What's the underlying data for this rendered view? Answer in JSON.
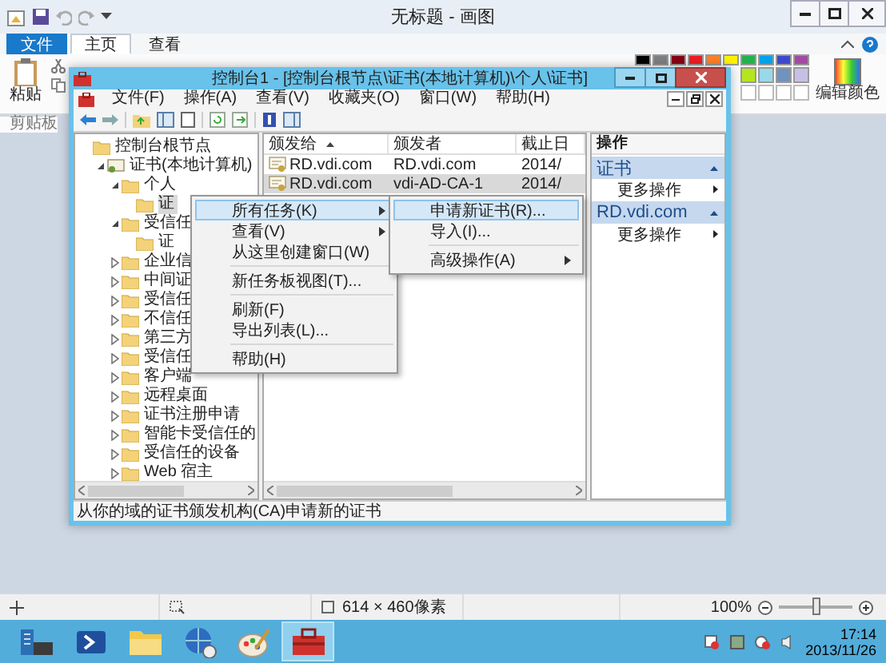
{
  "paint": {
    "title": "无标题 - 画图",
    "tabs": [
      {
        "label": "文件",
        "kind": "file",
        "selected": false
      },
      {
        "label": "主页",
        "kind": "tab",
        "selected": true
      },
      {
        "label": "查看",
        "kind": "tab",
        "selected": false
      }
    ],
    "ribbon": {
      "paste_label": "粘贴",
      "group_label": "剪贴板",
      "edit_colors_label": "编辑颜色",
      "palette_top": [
        {
          "color": "#000000"
        },
        {
          "color": "#7f7f7f"
        },
        {
          "color": "#880015"
        },
        {
          "color": "#ed1c24"
        },
        {
          "color": "#ff7f27"
        },
        {
          "color": "#fff200"
        },
        {
          "color": "#22b14c"
        },
        {
          "color": "#00a2e8"
        },
        {
          "color": "#3f48cc"
        },
        {
          "color": "#a349a4"
        }
      ],
      "palette_second": [
        {
          "color": "#b5e61d"
        },
        {
          "color": "#99d9ea"
        },
        {
          "color": "#7092be"
        },
        {
          "color": "#c8bfe7"
        }
      ]
    },
    "status": {
      "size": "614 × 460像素",
      "zoom": "100%",
      "level": 0.5
    }
  },
  "mmc": {
    "title": "控制台1 - [控制台根节点\\证书(本地计算机)\\个人\\证书]",
    "menu": [
      "文件(F)",
      "操作(A)",
      "查看(V)",
      "收藏夹(O)",
      "窗口(W)",
      "帮助(H)"
    ],
    "tree": [
      {
        "label": "控制台根节点",
        "kind": "plain",
        "selected": false,
        "children": [
          {
            "label": "证书(本地计算机)",
            "kind": "store",
            "expanded": true,
            "selected": false,
            "children": [
              {
                "label": "个人",
                "kind": "folder",
                "expanded": true,
                "selected": false,
                "children": [
                  {
                    "label": "证",
                    "kind": "plain",
                    "selected": true
                  }
                ]
              },
              {
                "label": "受信任",
                "kind": "folder",
                "expanded": true,
                "selected": false,
                "children": [
                  {
                    "label": "证",
                    "kind": "plain",
                    "selected": false
                  }
                ]
              },
              {
                "label": "企业信",
                "kind": "folder",
                "expanded": false,
                "selected": false
              },
              {
                "label": "中间证",
                "kind": "folder",
                "expanded": false,
                "selected": false
              },
              {
                "label": "受信任",
                "kind": "folder",
                "expanded": false,
                "selected": false
              },
              {
                "label": "不信任",
                "kind": "folder",
                "expanded": false,
                "selected": false
              },
              {
                "label": "第三方",
                "kind": "folder",
                "expanded": false,
                "selected": false
              },
              {
                "label": "受信任",
                "kind": "folder",
                "expanded": false,
                "selected": false
              },
              {
                "label": "客户端",
                "kind": "folder",
                "expanded": false,
                "selected": false
              },
              {
                "label": "远程桌面",
                "kind": "folder",
                "expanded": false,
                "selected": false
              },
              {
                "label": "证书注册申请",
                "kind": "folder",
                "expanded": false,
                "selected": false
              },
              {
                "label": "智能卡受信任的",
                "kind": "folder",
                "expanded": false,
                "selected": false
              },
              {
                "label": "受信任的设备",
                "kind": "folder",
                "expanded": false,
                "selected": false
              },
              {
                "label": "Web 宿主",
                "kind": "folder",
                "expanded": false,
                "selected": false
              }
            ]
          }
        ]
      }
    ],
    "columns": [
      {
        "label": "颁发给",
        "sorted": true
      },
      {
        "label": "颁发者",
        "sorted": false
      },
      {
        "label": "截止日",
        "sorted": false
      }
    ],
    "rows": [
      {
        "cells": [
          "RD.vdi.com",
          "RD.vdi.com",
          "2014/"
        ],
        "selected": false
      },
      {
        "cells": [
          "RD.vdi.com",
          "vdi-AD-CA-1",
          "2014/"
        ],
        "selected": true
      }
    ],
    "actions": {
      "title": "操作",
      "sections": [
        {
          "title": "证书",
          "items": [
            "更多操作"
          ]
        },
        {
          "title": "RD.vdi.com",
          "items": [
            "更多操作"
          ]
        }
      ]
    },
    "context_menu": [
      {
        "kind": "item",
        "label": "所有任务(K)",
        "submenu": true,
        "selected": true
      },
      {
        "kind": "item",
        "label": "查看(V)",
        "submenu": true,
        "selected": false
      },
      {
        "kind": "item",
        "label": "从这里创建窗口(W)",
        "submenu": false,
        "selected": false
      },
      {
        "kind": "separator"
      },
      {
        "kind": "item",
        "label": "新任务板视图(T)...",
        "submenu": false,
        "selected": false
      },
      {
        "kind": "separator"
      },
      {
        "kind": "item",
        "label": "刷新(F)",
        "submenu": false,
        "selected": false
      },
      {
        "kind": "item",
        "label": "导出列表(L)...",
        "submenu": false,
        "selected": false
      },
      {
        "kind": "separator"
      },
      {
        "kind": "item",
        "label": "帮助(H)",
        "submenu": false,
        "selected": false
      }
    ],
    "submenu": [
      {
        "kind": "item",
        "label": "申请新证书(R)...",
        "submenu": false,
        "selected": true
      },
      {
        "kind": "item",
        "label": "导入(I)...",
        "submenu": false,
        "selected": false
      },
      {
        "kind": "separator"
      },
      {
        "kind": "item",
        "label": "高级操作(A)",
        "submenu": true,
        "selected": false
      }
    ],
    "status": "从你的域的证书颁发机构(CA)申请新的证书"
  },
  "taskbar": {
    "apps": [
      {
        "kind": "server",
        "selected": false
      },
      {
        "kind": "shell",
        "selected": false
      },
      {
        "kind": "explorer",
        "selected": false
      },
      {
        "kind": "network",
        "selected": false
      },
      {
        "kind": "paint",
        "selected": false
      },
      {
        "kind": "toolbox",
        "selected": true
      }
    ],
    "time": "17:14",
    "date": "2013/11/26"
  }
}
